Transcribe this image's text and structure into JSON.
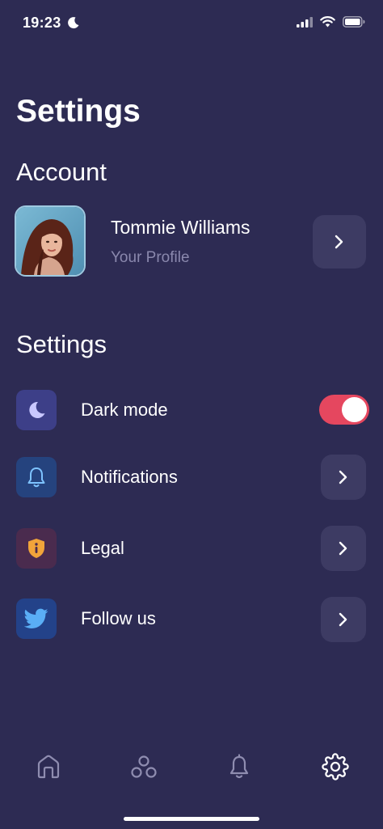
{
  "status": {
    "time": "19:23"
  },
  "page_title": "Settings",
  "account": {
    "section_title": "Account",
    "name": "Tommie Williams",
    "subtitle": "Your Profile"
  },
  "settings": {
    "section_title": "Settings",
    "items": [
      {
        "label": "Dark mode",
        "icon": "moon-icon",
        "icon_bg": "#3d3f88",
        "control": "toggle",
        "toggle_on": true
      },
      {
        "label": "Notifications",
        "icon": "bell-icon",
        "icon_bg": "#25437e",
        "control": "chevron"
      },
      {
        "label": "Legal",
        "icon": "shield-info-icon",
        "icon_bg": "#4a2b4e",
        "control": "chevron"
      },
      {
        "label": "Follow us",
        "icon": "twitter-icon",
        "icon_bg": "#234289",
        "control": "chevron"
      }
    ]
  },
  "tab_bar": {
    "items": [
      {
        "icon": "home-icon"
      },
      {
        "icon": "community-icon"
      },
      {
        "icon": "bell-icon"
      },
      {
        "icon": "gear-icon",
        "active": true
      }
    ]
  },
  "colors": {
    "background": "#2d2b53",
    "card": "#3d3b63",
    "accent_toggle": "#e5475f",
    "muted_text": "#8a88ad"
  }
}
